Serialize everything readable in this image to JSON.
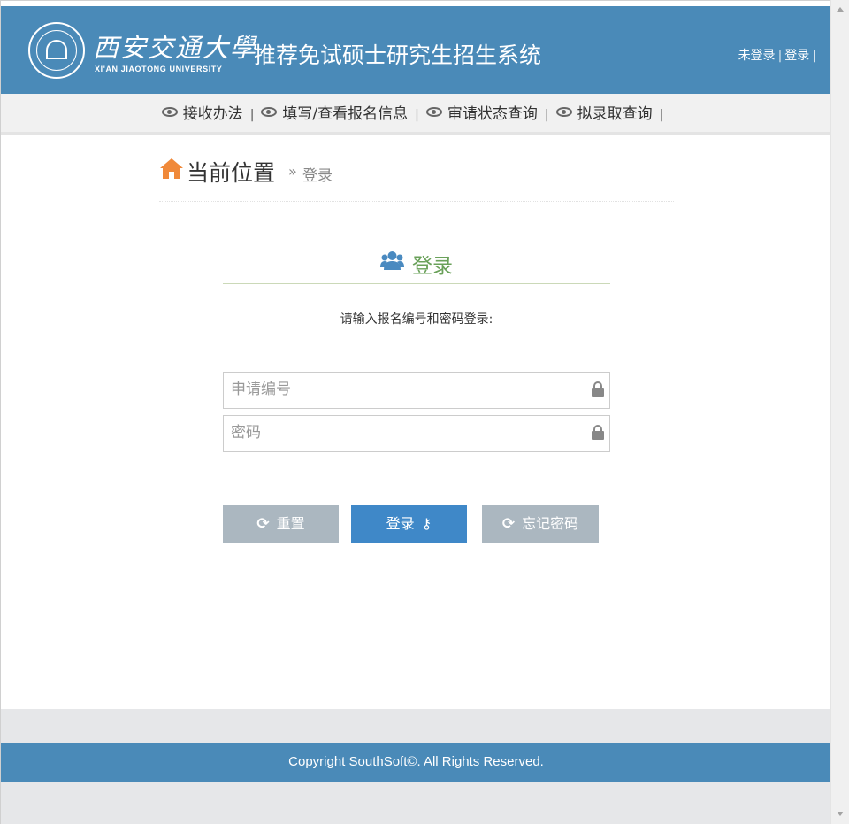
{
  "header": {
    "logo_cn": "西安交通大學",
    "logo_en": "XI'AN JIAOTONG UNIVERSITY",
    "system_title": "推荐免试硕士研究生招生系统",
    "user_status": "未登录",
    "user_separator": "|",
    "login_link": "登录",
    "trailing_separator": "|"
  },
  "nav": {
    "items": [
      {
        "label": "接收办法",
        "icon": "eye-icon"
      },
      {
        "label": "填写/查看报名信息",
        "icon": "eye-icon"
      },
      {
        "label": "审请状态查询",
        "icon": "eye-icon"
      },
      {
        "label": "拟录取查询",
        "icon": "eye-icon"
      }
    ],
    "divider": "|"
  },
  "breadcrumb": {
    "icon": "home-icon",
    "title": "当前位置",
    "separator": "»",
    "current": "登录"
  },
  "login": {
    "icon": "users-icon",
    "title": "登录",
    "hint": "请输入报名编号和密码登录:",
    "id_field": {
      "placeholder": "申请编号",
      "value": "",
      "icon": "lock-icon"
    },
    "password_field": {
      "placeholder": "密码",
      "value": "",
      "icon": "lock-icon"
    },
    "buttons": {
      "reset": "重置",
      "submit": "登录",
      "forgot": "忘记密码"
    }
  },
  "footer": {
    "copyright": "Copyright SouthSoft©. All Rights Reserved."
  },
  "colors": {
    "header_bg": "#4a8ab8",
    "nav_bg": "#f1f1f1",
    "primary_button": "#3f88c8",
    "secondary_button": "#abb7c0",
    "login_title": "#6aa15a",
    "home_icon": "#f0893a",
    "users_icon": "#4a8ac0"
  }
}
